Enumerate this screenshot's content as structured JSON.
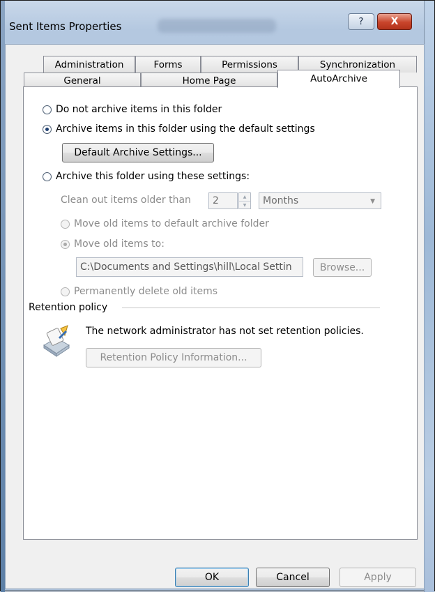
{
  "window": {
    "title": "Sent Items Properties",
    "help_glyph": "?",
    "close_glyph": "X"
  },
  "tabs": {
    "row1": [
      "Administration",
      "Forms",
      "Permissions",
      "Synchronization"
    ],
    "row2": [
      "General",
      "Home Page",
      "AutoArchive"
    ],
    "active": "AutoArchive"
  },
  "autoarchive": {
    "opt_no_archive": "Do not archive items in this folder",
    "opt_default": "Archive items in this folder using the default settings",
    "default_settings_button": "Default Archive Settings...",
    "opt_custom": "Archive this folder using these settings:",
    "clean_out_label": "Clean out items older than",
    "clean_out_value": "2",
    "period_value": "Months",
    "move_default": "Move old items to default archive folder",
    "move_to": "Move old items to:",
    "move_path": "C:\\Documents and Settings\\hill\\Local Settin",
    "browse_button": "Browse...",
    "delete_old": "Permanently delete old items"
  },
  "retention": {
    "group_label": "Retention policy",
    "message": "The network administrator has not set retention policies.",
    "info_button": "Retention Policy Information..."
  },
  "footer": {
    "ok": "OK",
    "cancel": "Cancel",
    "apply": "Apply"
  },
  "colors": {
    "close_red": "#c8442b",
    "frame_blue": "#b4c8e0",
    "dialog_bg": "#f0f0f0"
  }
}
